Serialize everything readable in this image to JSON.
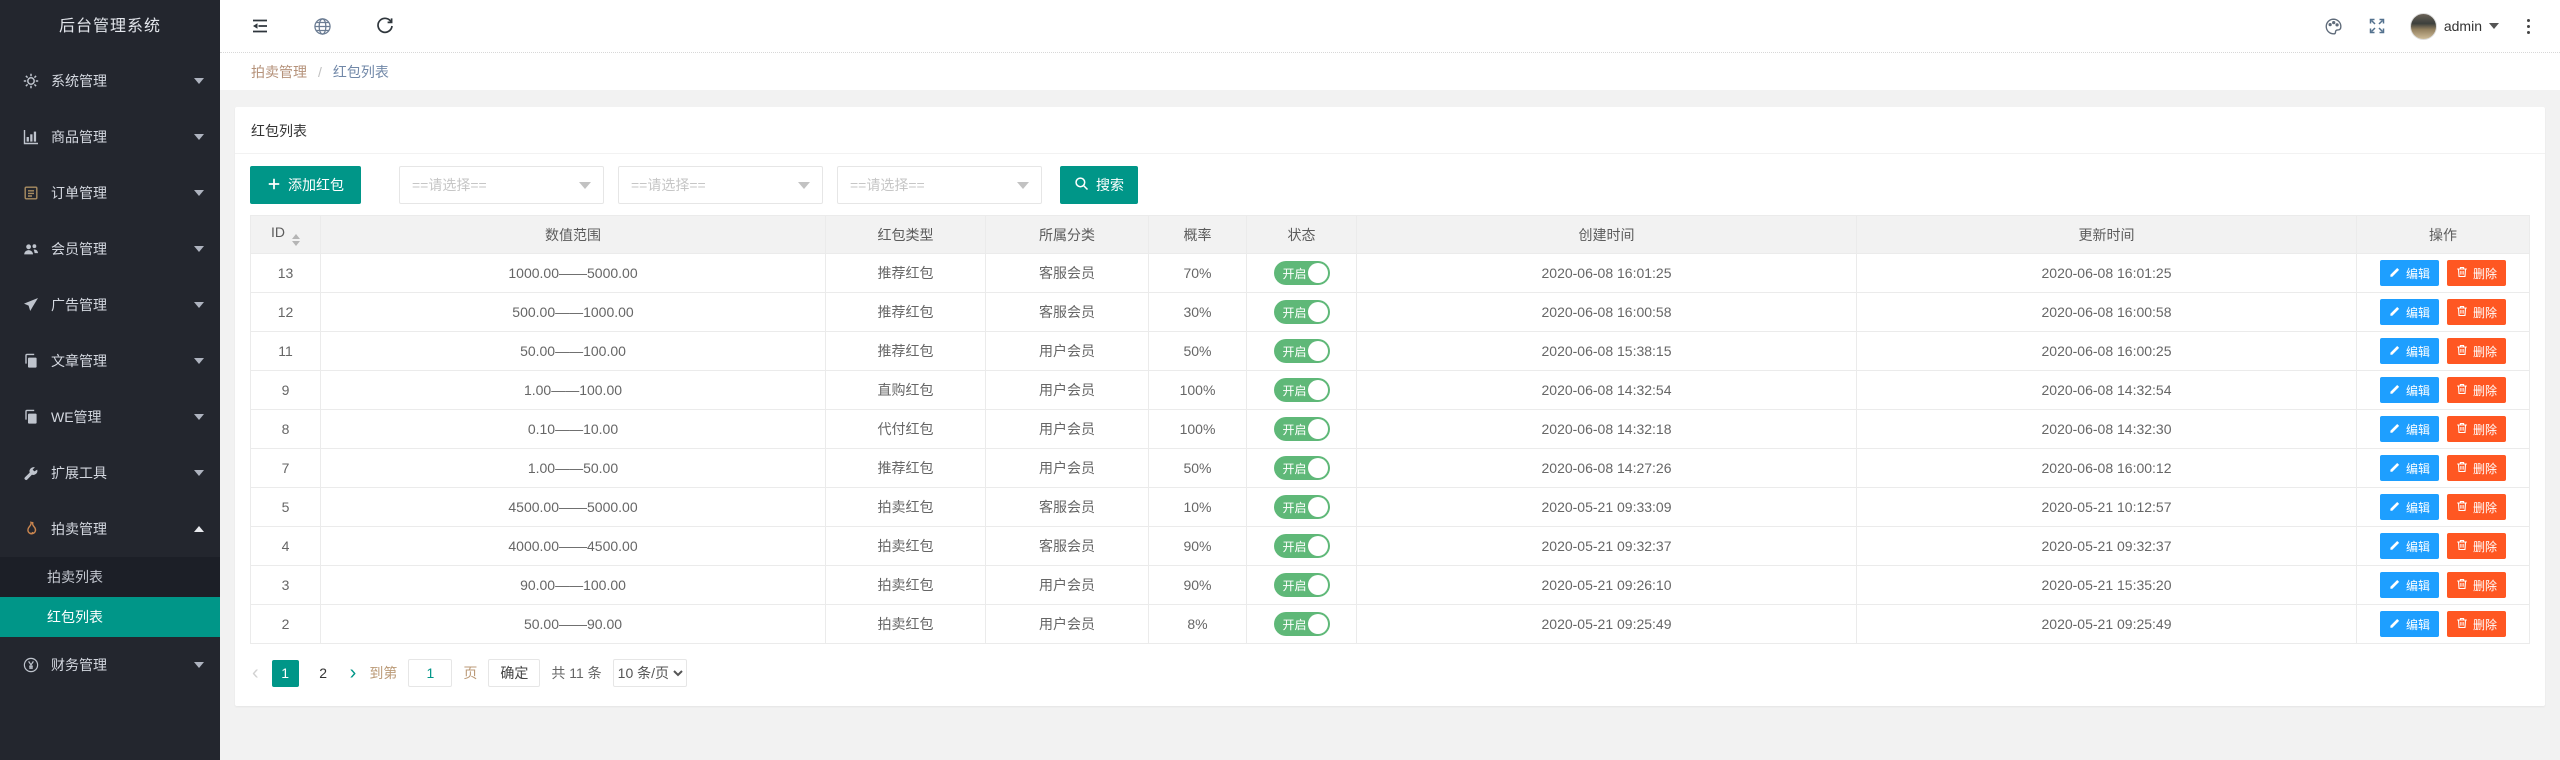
{
  "app": {
    "title": "后台管理系统"
  },
  "topbar": {
    "username": "admin"
  },
  "sidebar": {
    "items": [
      {
        "label": "系统管理"
      },
      {
        "label": "商品管理"
      },
      {
        "label": "订单管理"
      },
      {
        "label": "会员管理"
      },
      {
        "label": "广告管理"
      },
      {
        "label": "文章管理"
      },
      {
        "label": "WE管理"
      },
      {
        "label": "扩展工具"
      },
      {
        "label": "拍卖管理"
      },
      {
        "label": "财务管理"
      }
    ],
    "submenu": {
      "items": [
        {
          "label": "拍卖列表",
          "active": false
        },
        {
          "label": "红包列表",
          "active": true
        }
      ]
    }
  },
  "breadcrumb": {
    "parent": "拍卖管理",
    "separator": "/",
    "current": "红包列表"
  },
  "panel": {
    "title": "红包列表"
  },
  "toolbar": {
    "add_label": "添加红包",
    "select1_placeholder": "==请选择==",
    "select2_placeholder": "==请选择==",
    "select3_placeholder": "==请选择==",
    "search_label": "搜索"
  },
  "table": {
    "columns": [
      "ID",
      "数值范围",
      "红包类型",
      "所属分类",
      "概率",
      "状态",
      "创建时间",
      "更新时间",
      "操作"
    ],
    "edit_label": "编辑",
    "delete_label": "删除",
    "rows": [
      {
        "id": "13",
        "range": "1000.00——5000.00",
        "type": "推荐红包",
        "category": "客服会员",
        "probability": "70%",
        "status": "开启",
        "created": "2020-06-08 16:01:25",
        "updated": "2020-06-08 16:01:25"
      },
      {
        "id": "12",
        "range": "500.00——1000.00",
        "type": "推荐红包",
        "category": "客服会员",
        "probability": "30%",
        "status": "开启",
        "created": "2020-06-08 16:00:58",
        "updated": "2020-06-08 16:00:58"
      },
      {
        "id": "11",
        "range": "50.00——100.00",
        "type": "推荐红包",
        "category": "用户会员",
        "probability": "50%",
        "status": "开启",
        "created": "2020-06-08 15:38:15",
        "updated": "2020-06-08 16:00:25"
      },
      {
        "id": "9",
        "range": "1.00——100.00",
        "type": "直购红包",
        "category": "用户会员",
        "probability": "100%",
        "status": "开启",
        "created": "2020-06-08 14:32:54",
        "updated": "2020-06-08 14:32:54"
      },
      {
        "id": "8",
        "range": "0.10——10.00",
        "type": "代付红包",
        "category": "用户会员",
        "probability": "100%",
        "status": "开启",
        "created": "2020-06-08 14:32:18",
        "updated": "2020-06-08 14:32:30"
      },
      {
        "id": "7",
        "range": "1.00——50.00",
        "type": "推荐红包",
        "category": "用户会员",
        "probability": "50%",
        "status": "开启",
        "created": "2020-06-08 14:27:26",
        "updated": "2020-06-08 16:00:12"
      },
      {
        "id": "5",
        "range": "4500.00——5000.00",
        "type": "拍卖红包",
        "category": "客服会员",
        "probability": "10%",
        "status": "开启",
        "created": "2020-05-21 09:33:09",
        "updated": "2020-05-21 10:12:57"
      },
      {
        "id": "4",
        "range": "4000.00——4500.00",
        "type": "拍卖红包",
        "category": "客服会员",
        "probability": "90%",
        "status": "开启",
        "created": "2020-05-21 09:32:37",
        "updated": "2020-05-21 09:32:37"
      },
      {
        "id": "3",
        "range": "90.00——100.00",
        "type": "拍卖红包",
        "category": "用户会员",
        "probability": "90%",
        "status": "开启",
        "created": "2020-05-21 09:26:10",
        "updated": "2020-05-21 15:35:20"
      },
      {
        "id": "2",
        "range": "50.00——90.00",
        "type": "拍卖红包",
        "category": "用户会员",
        "probability": "8%",
        "status": "开启",
        "created": "2020-05-21 09:25:49",
        "updated": "2020-05-21 09:25:49"
      }
    ]
  },
  "pagination": {
    "prev": "‹",
    "pages": [
      "1",
      "2"
    ],
    "active_page": "1",
    "next": "›",
    "goto_prefix": "到第",
    "goto_value": "1",
    "goto_suffix": "页",
    "confirm": "确定",
    "total": "共 11 条",
    "page_size": "10 条/页"
  },
  "colors": {
    "accent_teal": "#009688",
    "toggle_green": "#5FB878",
    "edit_blue": "#1E9FFF",
    "delete_orange": "#FF5722",
    "sidebar_bg": "#23262e"
  }
}
